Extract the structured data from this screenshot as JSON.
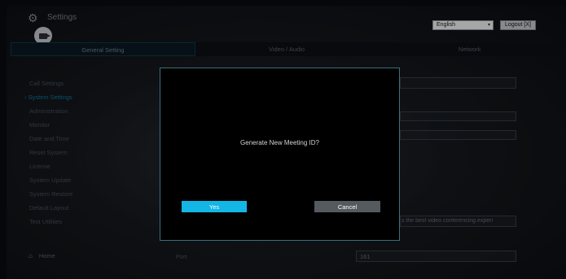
{
  "header": {
    "title": "Settings",
    "language": "English",
    "logout_label": "Logout [X]"
  },
  "tabs": [
    {
      "label": "General Setting",
      "active": true
    },
    {
      "label": "Video / Audio",
      "active": false
    },
    {
      "label": "Network",
      "active": false
    }
  ],
  "sidebar": {
    "items": [
      {
        "label": "Call Settings",
        "active": false
      },
      {
        "label": "System Settings",
        "active": true
      },
      {
        "label": "Administration",
        "active": false
      },
      {
        "label": "Monitor",
        "active": false
      },
      {
        "label": "Date and Time",
        "active": false
      },
      {
        "label": "Reset System",
        "active": false
      },
      {
        "label": "License",
        "active": false
      },
      {
        "label": "System Update",
        "active": false
      },
      {
        "label": "System Restore",
        "active": false
      },
      {
        "label": "Default Layout",
        "active": false
      },
      {
        "label": "Test Utilities",
        "active": false
      }
    ],
    "home_label": "Home"
  },
  "form": {
    "port_label": "Port",
    "port_value": "161",
    "description_value": "s the best video conferencing experi"
  },
  "dialog": {
    "message": "Generate New Meeting ID?",
    "yes_label": "Yes",
    "cancel_label": "Cancel"
  },
  "colors": {
    "accent": "#14b6e6",
    "cancel": "#555a5f",
    "modal_border": "#3a6f7e"
  }
}
